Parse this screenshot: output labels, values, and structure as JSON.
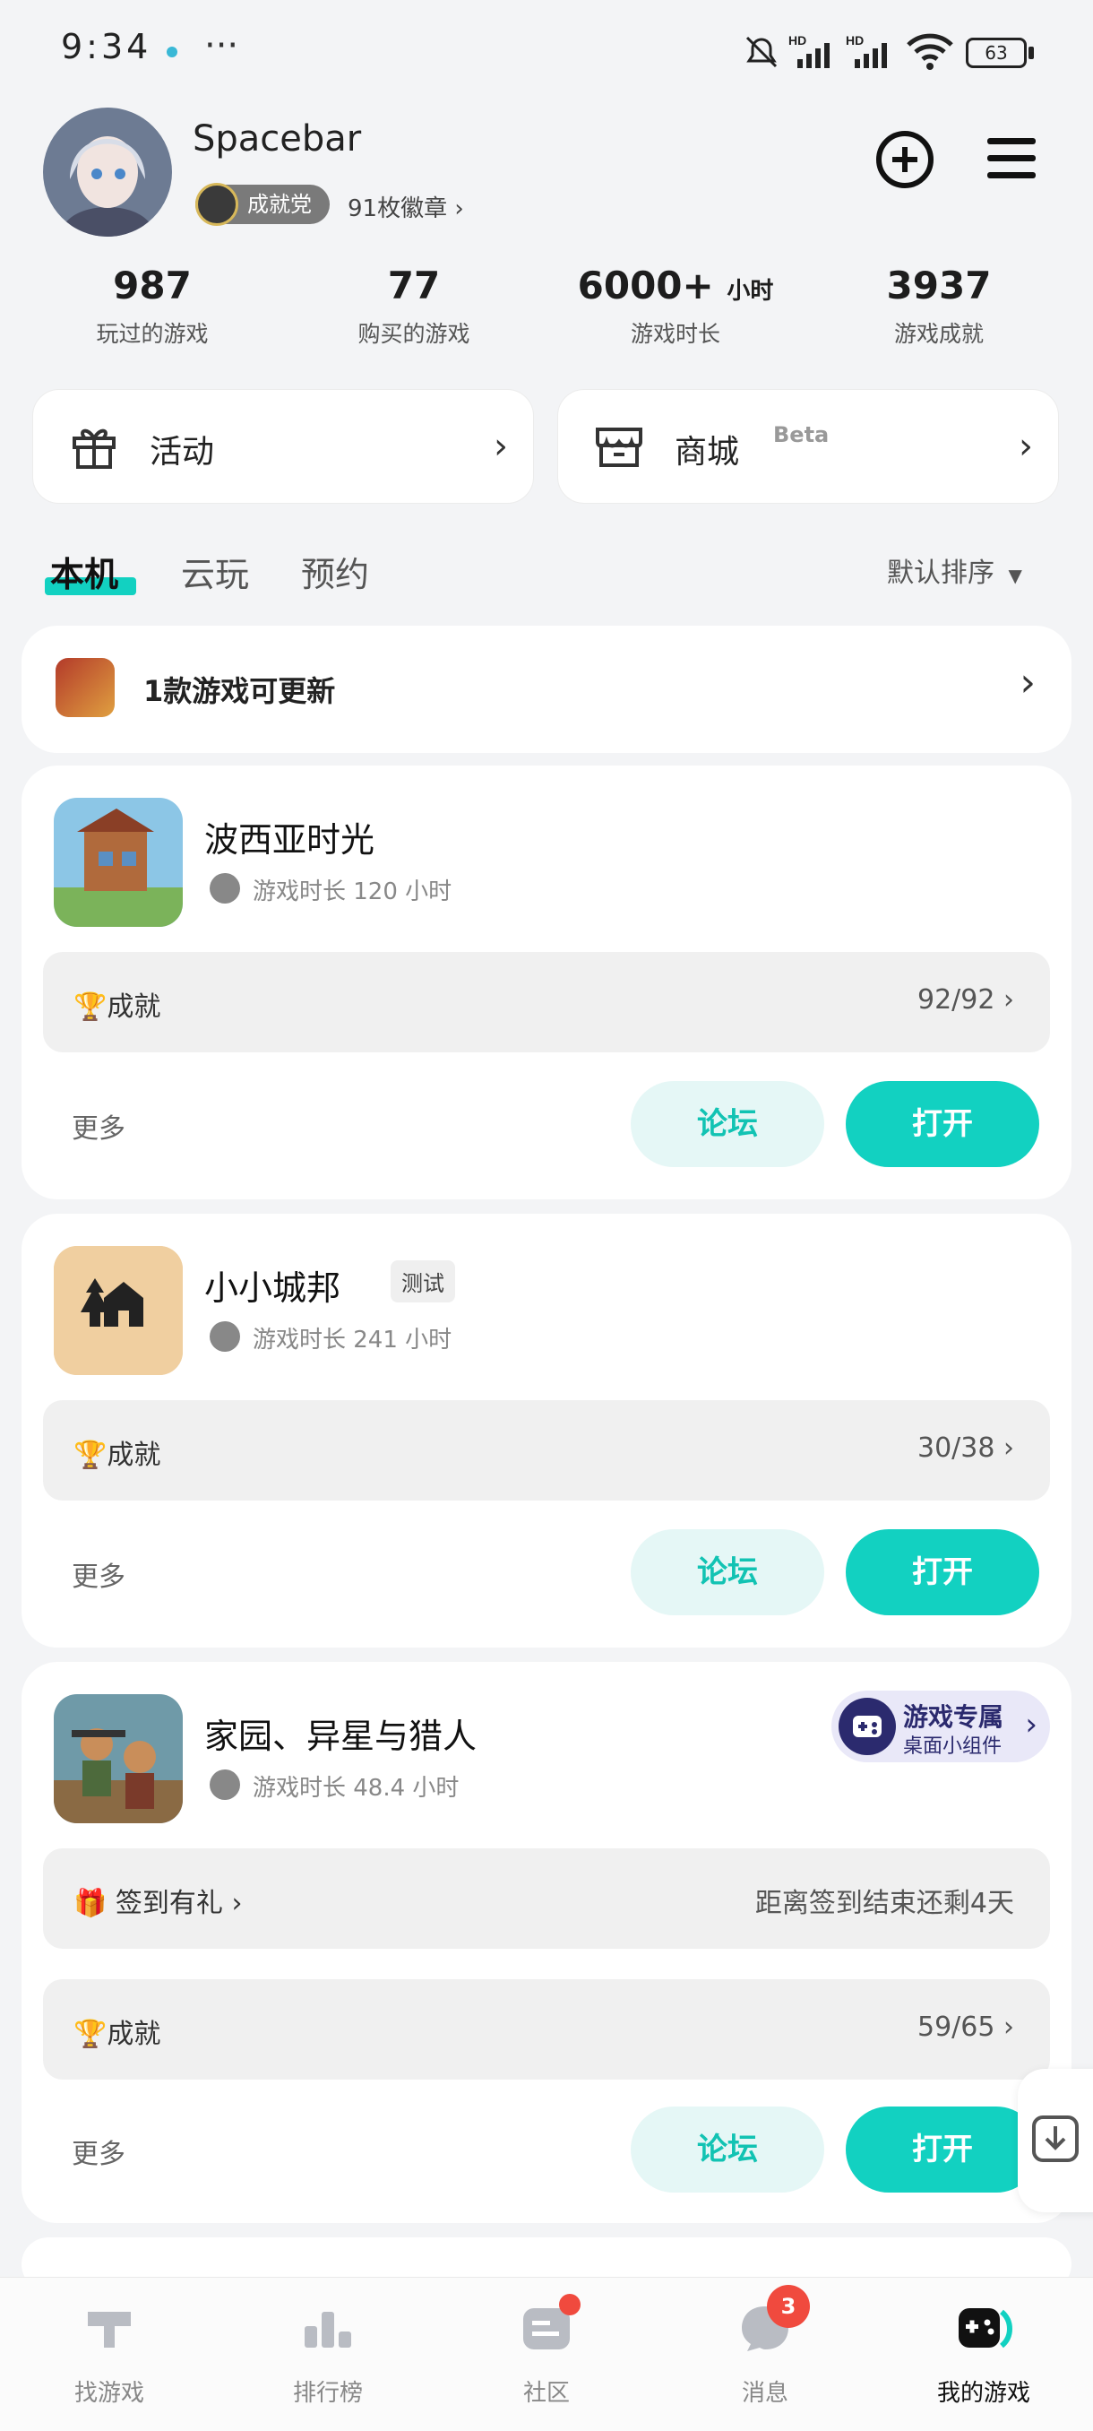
{
  "status_bar": {
    "time": "9:34",
    "more": "···",
    "battery": "63",
    "signal_labels": [
      "HD",
      "HD"
    ]
  },
  "profile": {
    "username": "Spacebar",
    "badge": "成就党",
    "medals": "91枚徽章 ›"
  },
  "stats": [
    {
      "num": "987",
      "unit": "",
      "label": "玩过的游戏"
    },
    {
      "num": "77",
      "unit": "",
      "label": "购买的游戏"
    },
    {
      "num": "6000+",
      "unit": "小时",
      "label": "游戏时长"
    },
    {
      "num": "3937",
      "unit": "",
      "label": "游戏成就"
    }
  ],
  "quick": {
    "activity": "活动",
    "store": "商城",
    "beta": "Beta"
  },
  "tabs": [
    "本机",
    "云玩",
    "预约"
  ],
  "sort": "默认排序",
  "update_notice": "1款游戏可更新",
  "games": [
    {
      "title": "波西亚时光",
      "time": "游戏时长 120 小时",
      "achievement_label": "成就",
      "achievement_count": "92/92",
      "more": "更多",
      "forum": "论坛",
      "open": "打开"
    },
    {
      "title": "小小城邦",
      "tag": "测试",
      "time": "游戏时长 241 小时",
      "achievement_label": "成就",
      "achievement_count": "30/38",
      "more": "更多",
      "forum": "论坛",
      "open": "打开"
    },
    {
      "title": "家园、异星与猎人",
      "time": "游戏时长 48.4 小时",
      "checkin_label": "签到有礼",
      "checkin_note": "距离签到结束还剩4天",
      "achievement_label": "成就",
      "achievement_count": "59/65",
      "more": "更多",
      "forum": "论坛",
      "open": "打开",
      "widget_title": "游戏专属",
      "widget_sub": "桌面小组件"
    }
  ],
  "bottom_nav": [
    {
      "label": "找游戏"
    },
    {
      "label": "排行榜"
    },
    {
      "label": "社区"
    },
    {
      "label": "消息",
      "badge": "3"
    },
    {
      "label": "我的游戏"
    }
  ],
  "colors": {
    "accent": "#12d1c1",
    "badge_red": "#f04a3e"
  }
}
